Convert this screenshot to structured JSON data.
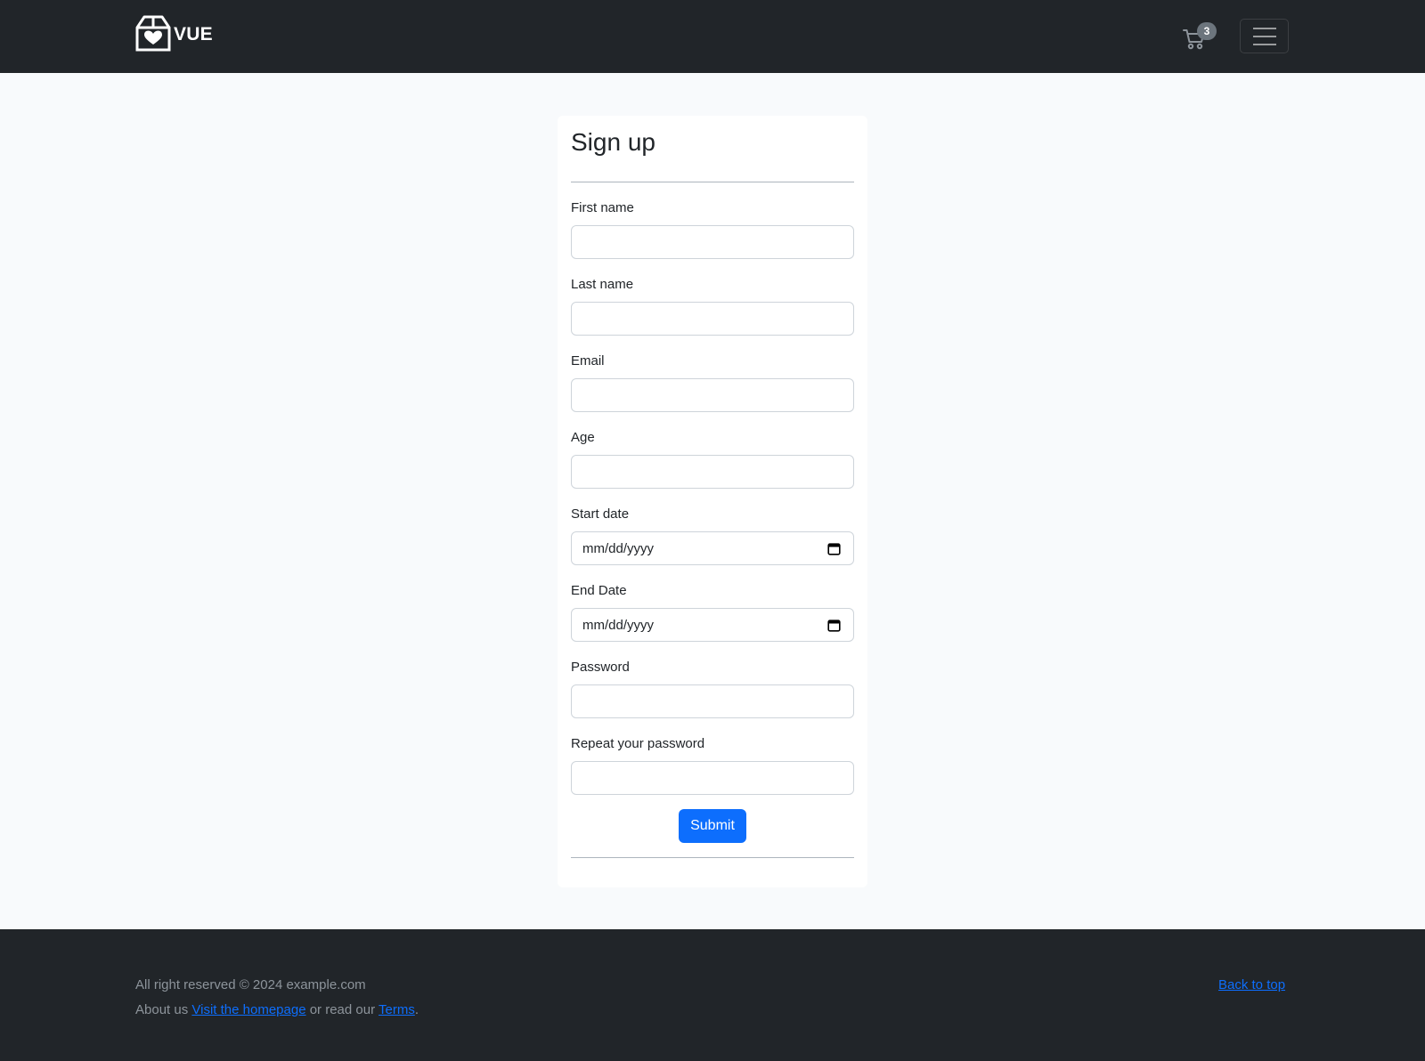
{
  "navbar": {
    "brand": "VUE",
    "logo_icon": "heart-box-icon",
    "cart": {
      "icon": "cart-icon",
      "count": "3"
    },
    "toggler_icon": "hamburger-icon"
  },
  "form": {
    "title": "Sign up",
    "fields": [
      {
        "label": "First name",
        "type": "text",
        "value": ""
      },
      {
        "label": "Last name",
        "type": "text",
        "value": ""
      },
      {
        "label": "Email",
        "type": "email",
        "value": ""
      },
      {
        "label": "Age",
        "type": "number",
        "value": ""
      },
      {
        "label": "Start date",
        "type": "date",
        "value": "mm/dd/yyyy"
      },
      {
        "label": "End Date",
        "type": "date",
        "value": "mm/dd/yyyy"
      },
      {
        "label": "Password",
        "type": "password",
        "value": ""
      },
      {
        "label": "Repeat your password",
        "type": "password",
        "value": ""
      }
    ],
    "submit_label": "Submit"
  },
  "footer": {
    "copyright": "All right reserved © 2024 example.com",
    "about_prefix": "About us ",
    "homepage_link": "Visit the homepage",
    "middle_text": " or read our ",
    "terms_link": "Terms",
    "end_text": ".",
    "back_to_top": "Back to top"
  },
  "colors": {
    "navbar_bg": "#212529",
    "page_bg": "#f8fafc",
    "primary": "#0d6efd",
    "badge": "#6c757d"
  }
}
